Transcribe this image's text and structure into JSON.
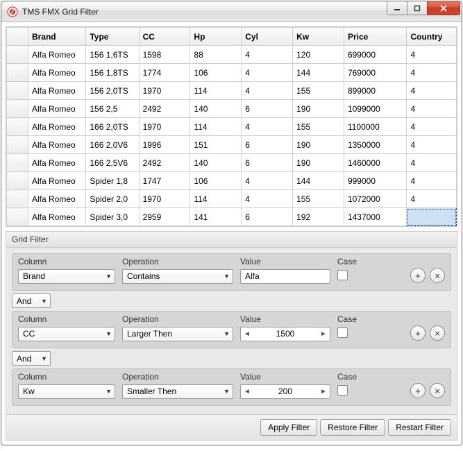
{
  "window": {
    "title": "TMS FMX Grid Filter"
  },
  "grid": {
    "headers": [
      "Brand",
      "Type",
      "CC",
      "Hp",
      "Cyl",
      "Kw",
      "Price",
      "Country"
    ],
    "rows": [
      [
        "Alfa Romeo",
        "156 1,6TS",
        "1598",
        "88",
        "4",
        "120",
        "699000",
        "4"
      ],
      [
        "Alfa Romeo",
        "156 1,8TS",
        "1774",
        "106",
        "4",
        "144",
        "769000",
        "4"
      ],
      [
        "Alfa Romeo",
        "156 2,0TS",
        "1970",
        "114",
        "4",
        "155",
        "899000",
        "4"
      ],
      [
        "Alfa Romeo",
        "156 2,5",
        "2492",
        "140",
        "6",
        "190",
        "1099000",
        "4"
      ],
      [
        "Alfa Romeo",
        "166 2,0TS",
        "1970",
        "114",
        "4",
        "155",
        "1100000",
        "4"
      ],
      [
        "Alfa Romeo",
        "166 2,0V6",
        "1996",
        "151",
        "6",
        "190",
        "1350000",
        "4"
      ],
      [
        "Alfa Romeo",
        "166 2,5V6",
        "2492",
        "140",
        "6",
        "190",
        "1460000",
        "4"
      ],
      [
        "Alfa Romeo",
        "Spider 1,8",
        "1747",
        "106",
        "4",
        "144",
        "999000",
        "4"
      ],
      [
        "Alfa Romeo",
        "Spider 2,0",
        "1970",
        "114",
        "4",
        "155",
        "1072000",
        "4"
      ],
      [
        "Alfa Romeo",
        "Spider 3,0",
        "2959",
        "141",
        "6",
        "192",
        "1437000",
        ""
      ]
    ],
    "selected_cell": {
      "row": 9,
      "col": 7
    }
  },
  "filter_panel": {
    "title": "Grid Filter",
    "labels": {
      "column": "Column",
      "operation": "Operation",
      "value": "Value",
      "case": "Case"
    },
    "rows": [
      {
        "column": "Brand",
        "operation": "Contains",
        "value_type": "text",
        "value": "Alfa",
        "case": false
      },
      {
        "column": "CC",
        "operation": "Larger Then",
        "value_type": "number",
        "value": "1500",
        "case": false
      },
      {
        "column": "Kw",
        "operation": "Smaller Then",
        "value_type": "number",
        "value": "200",
        "case": false
      }
    ],
    "joins": [
      "And",
      "And"
    ]
  },
  "footer": {
    "apply": "Apply Filter",
    "restore": "Restore Filter",
    "restart": "Restart Filter"
  }
}
